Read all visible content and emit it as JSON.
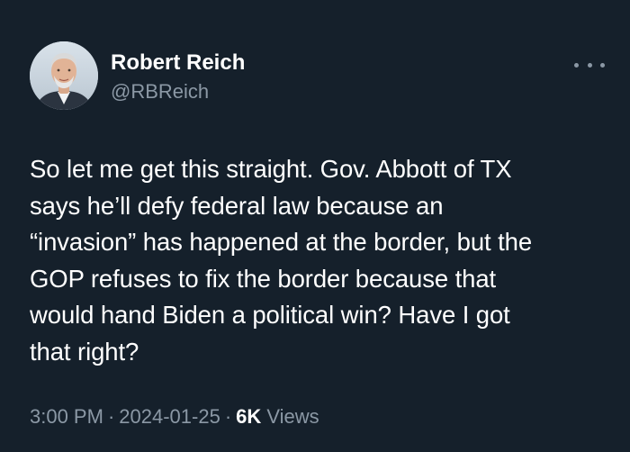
{
  "author": {
    "display_name": "Robert Reich",
    "handle": "@RBReich",
    "avatar_icon": "person-avatar-icon"
  },
  "more_icon": "more-horizontal-icon",
  "tweet": {
    "text": "So let me get this straight. Gov. Abbott of TX\nsays he’ll defy federal law because an\n“invasion” has happened at the border, but the\nGOP refuses to fix the border because that\nwould hand Biden a political win? Have I got\nthat right?"
  },
  "meta": {
    "time": "3:00 PM",
    "separator": "·",
    "date": "2024-01-25",
    "views_count": "6K",
    "views_label": "Views"
  },
  "colors": {
    "background": "#15202b",
    "text_primary": "#ffffff",
    "text_secondary": "#8b98a5"
  }
}
